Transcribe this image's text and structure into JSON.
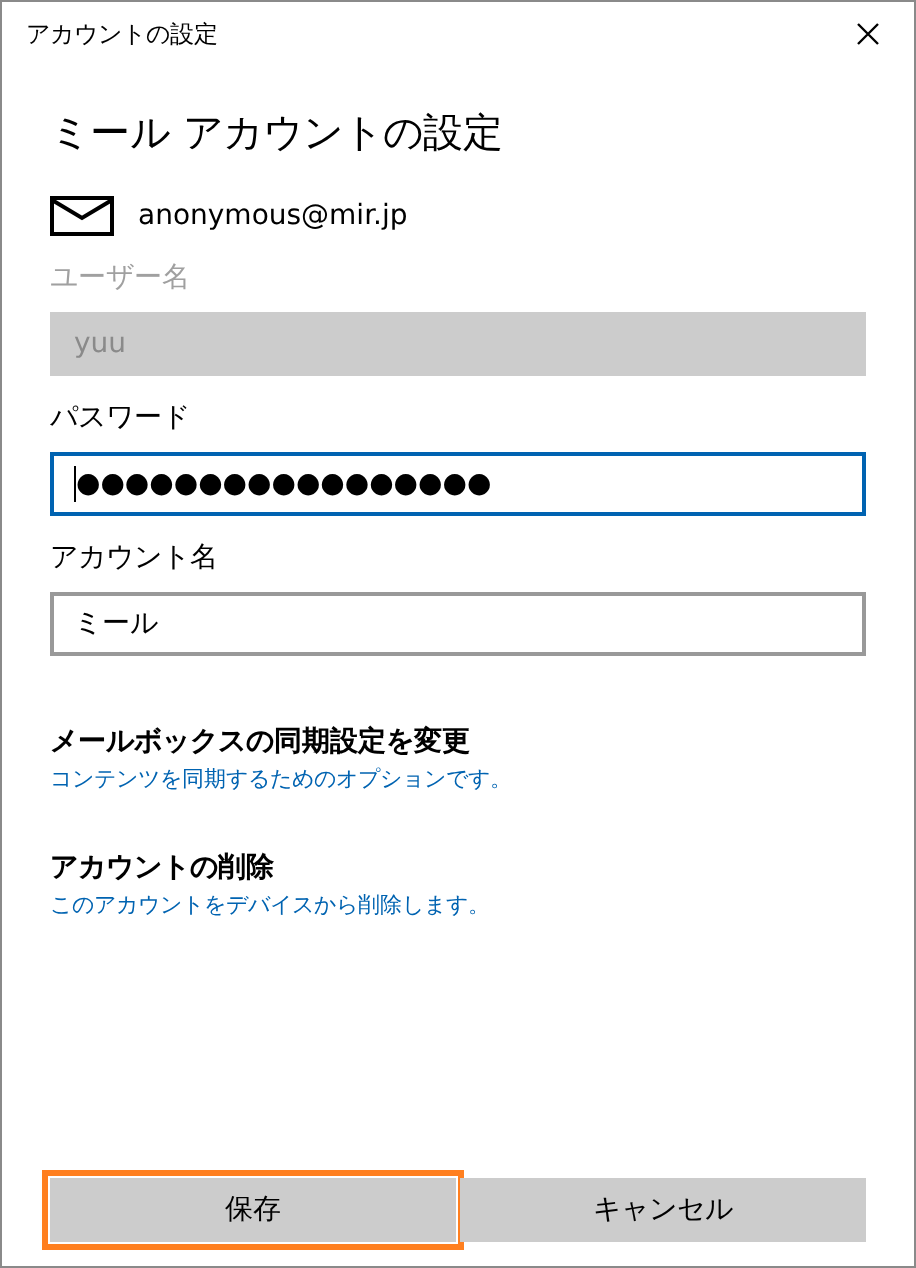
{
  "window": {
    "title": "アカウントの設定"
  },
  "heading": "ミール アカウントの設定",
  "account": {
    "email": "anonymous@mir.jp"
  },
  "fields": [
    {
      "label": "ユーザー名",
      "value": "yuu",
      "disabled": true,
      "focused": false
    },
    {
      "label": "パスワード",
      "value": "●●●●●●●●●●●●●●●●●",
      "disabled": false,
      "focused": true
    },
    {
      "label": "アカウント名",
      "value": "ミール",
      "disabled": false,
      "focused": false
    }
  ],
  "links": [
    {
      "title": "メールボックスの同期設定を変更",
      "description": "コンテンツを同期するためのオプションです。"
    },
    {
      "title": "アカウントの削除",
      "description": "このアカウントをデバイスから削除します。"
    }
  ],
  "buttons": [
    {
      "label": "保存",
      "highlighted": true
    },
    {
      "label": "キャンセル",
      "highlighted": false
    }
  ]
}
